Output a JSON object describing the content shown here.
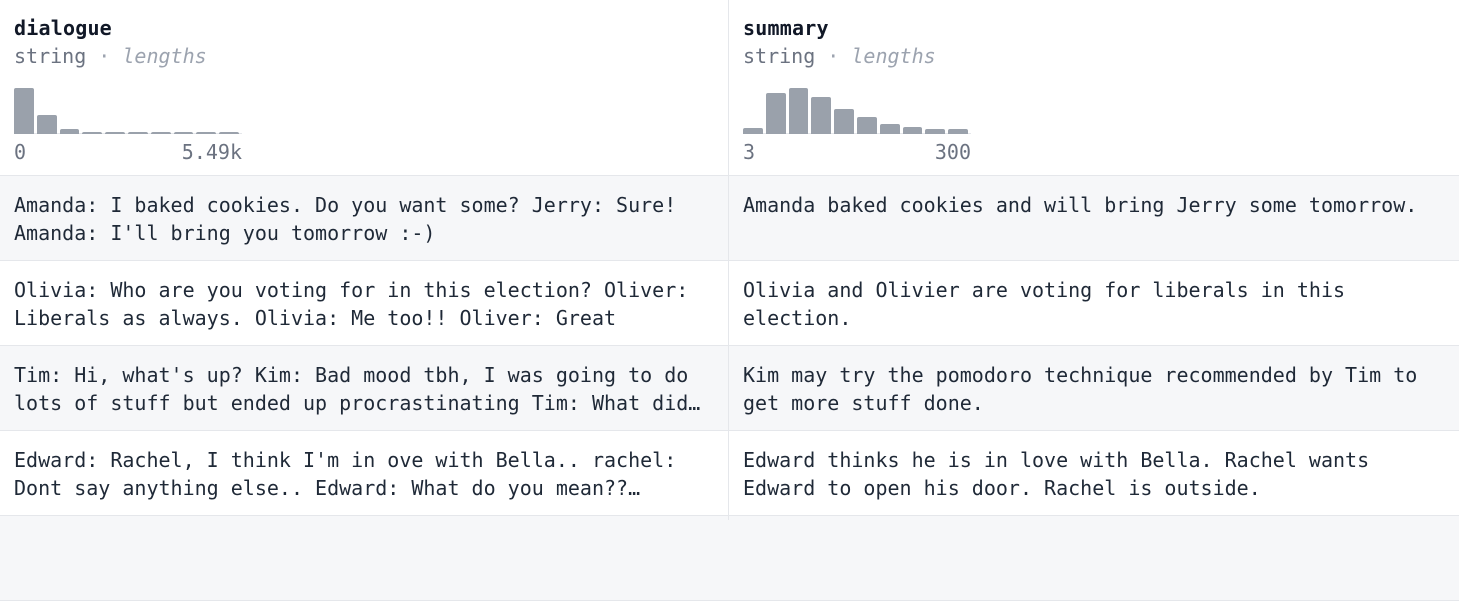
{
  "columns": [
    {
      "name": "dialogue",
      "type": "string",
      "separator": "·",
      "hint": "lengths",
      "axis_min": "0",
      "axis_max": "5.49k",
      "histogram": [
        1.0,
        0.42,
        0.1,
        0.04,
        0.04,
        0.04,
        0.04,
        0.04,
        0.02,
        0.04
      ]
    },
    {
      "name": "summary",
      "type": "string",
      "separator": "·",
      "hint": "lengths",
      "axis_min": "3",
      "axis_max": "300",
      "histogram": [
        0.13,
        0.9,
        1.0,
        0.8,
        0.55,
        0.36,
        0.22,
        0.15,
        0.1,
        0.1
      ]
    }
  ],
  "rows": [
    {
      "dialogue": "Amanda: I baked cookies. Do you want some? Jerry: Sure! Amanda: I'll bring you tomorrow :-)",
      "summary": "Amanda baked cookies and will bring Jerry some tomorrow."
    },
    {
      "dialogue": "Olivia: Who are you voting for in this election? Oliver: Liberals as always. Olivia: Me too!! Oliver: Great",
      "summary": "Olivia and Olivier are voting for liberals in this election."
    },
    {
      "dialogue": "Tim: Hi, what's up? Kim: Bad mood tbh, I was going to do lots of stuff but ended up procrastinating Tim: What did you plan on doing?",
      "summary": "Kim may try the pomodoro technique recommended by Tim to get more stuff done."
    },
    {
      "dialogue": "Edward: Rachel, I think I'm in ove with Bella.. rachel: Dont say anything else.. Edward: What do you mean?? rachel: Open your fu**ing door.. I'm outside",
      "summary": "Edward thinks he is in love with Bella. Rachel wants Edward to open his door. Rachel is outside."
    }
  ]
}
